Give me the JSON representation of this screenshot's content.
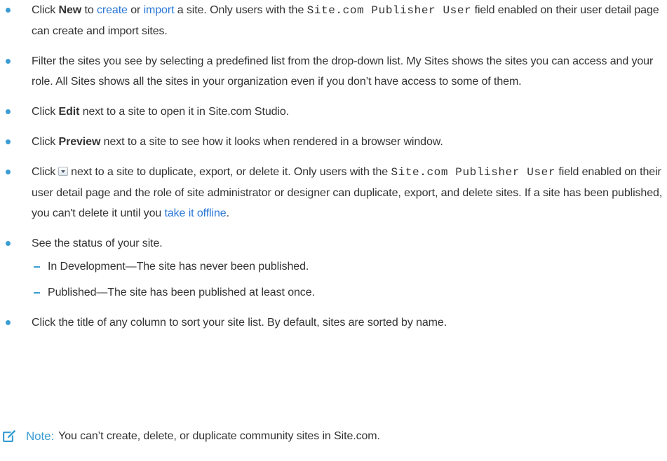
{
  "bullets": {
    "new": {
      "click": "Click ",
      "bold": "New",
      "to": " to ",
      "create_link": "create",
      "or": " or ",
      "import_link": "import",
      "text1": " a site. Only users with the ",
      "code": "Site.com Publisher User",
      "text2": " field enabled on their user detail page can create and import sites."
    },
    "filter": {
      "text": "Filter the sites you see by selecting a predefined list from the drop-down list. My Sites shows the sites you can access and your role. All Sites shows all the sites in your organization even if you don’t have access to some of them."
    },
    "edit": {
      "click": "Click ",
      "bold": "Edit",
      "text": " next to a site to open it in Site.com Studio."
    },
    "preview": {
      "click": "Click ",
      "bold": "Preview",
      "text": " next to a site to see how it looks when rendered in a browser window."
    },
    "menu": {
      "click": "Click",
      "text1": "next to a site to duplicate, export, or delete it. Only users with the ",
      "code": "Site.com Publisher User",
      "text2": " field enabled on their user detail page and the role of site administrator or designer can duplicate, export, and delete sites. If a site has been published, you can't delete it until you ",
      "offline_link": "take it offline",
      "end": "."
    },
    "status": {
      "text": "See the status of your site.",
      "sub": [
        "In Development—The site has never been published.",
        "Published—The site has been published at least once."
      ]
    },
    "sort": {
      "text": "Click the title of any column to sort your site list. By default, sites are sorted by name."
    }
  },
  "note": {
    "label": "Note:",
    "text": "You can’t create, delete, or duplicate community sites in Site.com."
  },
  "colors": {
    "accent": "#3b9dd3",
    "link": "#2a77d6",
    "text": "#333333"
  }
}
